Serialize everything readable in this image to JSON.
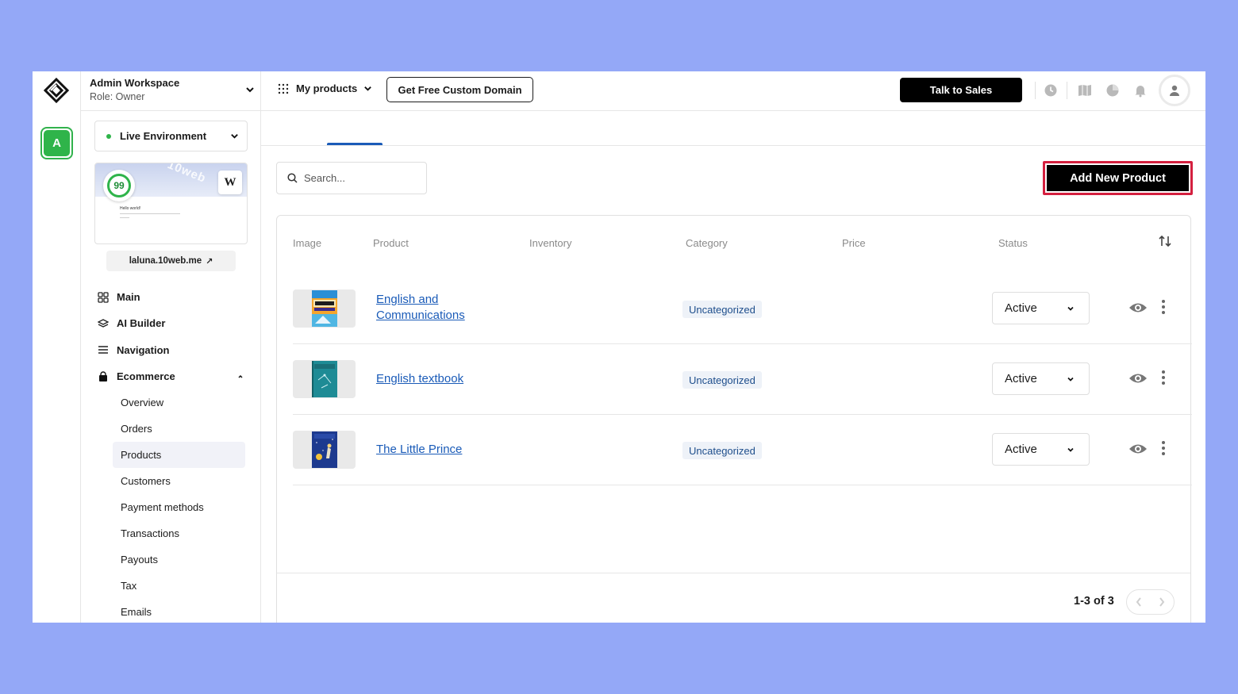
{
  "workspace": {
    "title": "Admin Workspace",
    "role": "Role: Owner"
  },
  "rail": {
    "avatar_letter": "A"
  },
  "environment": {
    "label": "Live Environment",
    "status_color": "#2fb44a"
  },
  "site_preview": {
    "score": "99",
    "watermark": "10web",
    "wp_mark": "W",
    "hello_text": "Hello world!"
  },
  "site_domain": "laluna.10web.me",
  "nav": {
    "items": [
      {
        "label": "Main",
        "icon": "grid-icon"
      },
      {
        "label": "AI Builder",
        "icon": "layers-icon"
      },
      {
        "label": "Navigation",
        "icon": "menu-icon"
      },
      {
        "label": "Ecommerce",
        "icon": "bag-icon"
      }
    ],
    "ecommerce_sub": [
      "Overview",
      "Orders",
      "Products",
      "Customers",
      "Payment methods",
      "Transactions",
      "Payouts",
      "Tax",
      "Emails"
    ],
    "active_sub": "Products"
  },
  "topbar": {
    "my_products": "My products",
    "custom_domain_btn": "Get Free Custom Domain",
    "talk_to_sales_btn": "Talk to Sales"
  },
  "search": {
    "placeholder": "Search..."
  },
  "add_product_btn": "Add New Product",
  "table": {
    "headers": [
      "Image",
      "Product",
      "Inventory",
      "Category",
      "Price",
      "Status"
    ],
    "rows": [
      {
        "name": "English and Communications",
        "category": "Uncategorized",
        "status": "Active"
      },
      {
        "name": "English textbook",
        "category": "Uncategorized",
        "status": "Active"
      },
      {
        "name": "The Little Prince",
        "category": "Uncategorized",
        "status": "Active"
      }
    ]
  },
  "pagination": {
    "label": "1-3 of 3"
  },
  "colors": {
    "accent": "#1a5bb8",
    "highlight_border": "#d4203f",
    "brand_green": "#2fb44a"
  }
}
